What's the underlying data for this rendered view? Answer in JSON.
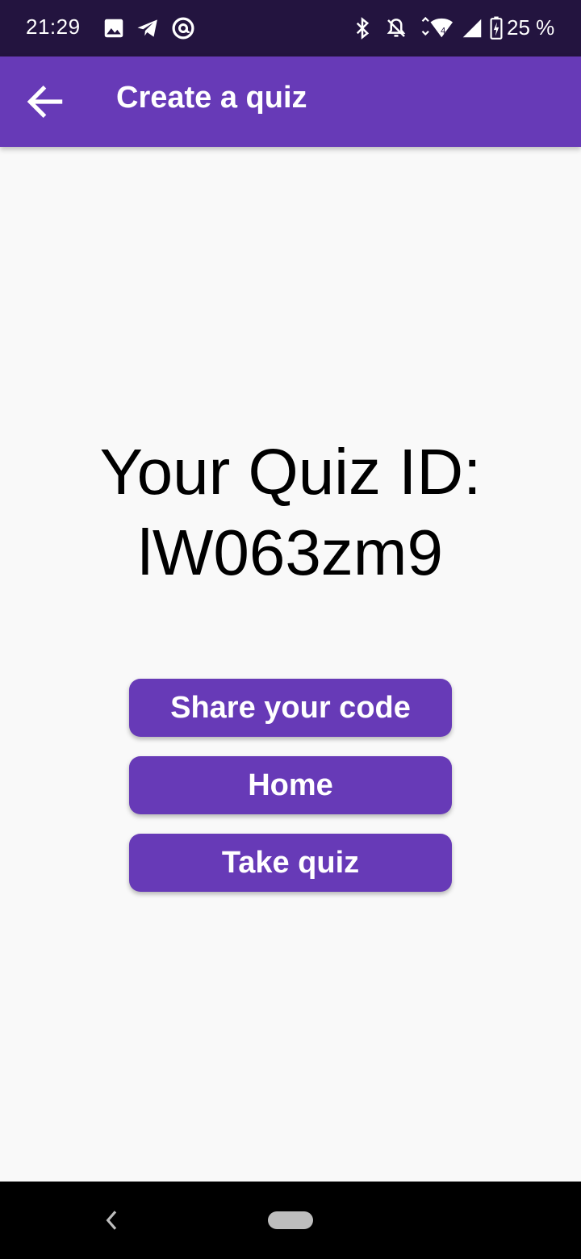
{
  "status_bar": {
    "time": "21:29",
    "battery_text": "25 %",
    "icons_left": [
      "image-icon",
      "telegram-icon",
      "at-sign-icon"
    ],
    "icons_right": [
      "bluetooth-icon",
      "bell-off-icon",
      "wifi-icon",
      "signal-icon",
      "battery-charging-icon"
    ],
    "background": "#23143f"
  },
  "app_bar": {
    "title": "Create a quiz",
    "back_icon": "arrow-back-icon",
    "background": "#673ab7"
  },
  "main": {
    "quiz_id_label": "Your Quiz ID:",
    "quiz_id_value": "lW063zm9"
  },
  "buttons": {
    "share_label": "Share your code",
    "home_label": "Home",
    "take_quiz_label": "Take quiz",
    "color": "#673ab7"
  },
  "nav_bar": {
    "back_icon": "nav-back-icon",
    "home_pill": "home-pill-icon",
    "background": "#000000"
  }
}
